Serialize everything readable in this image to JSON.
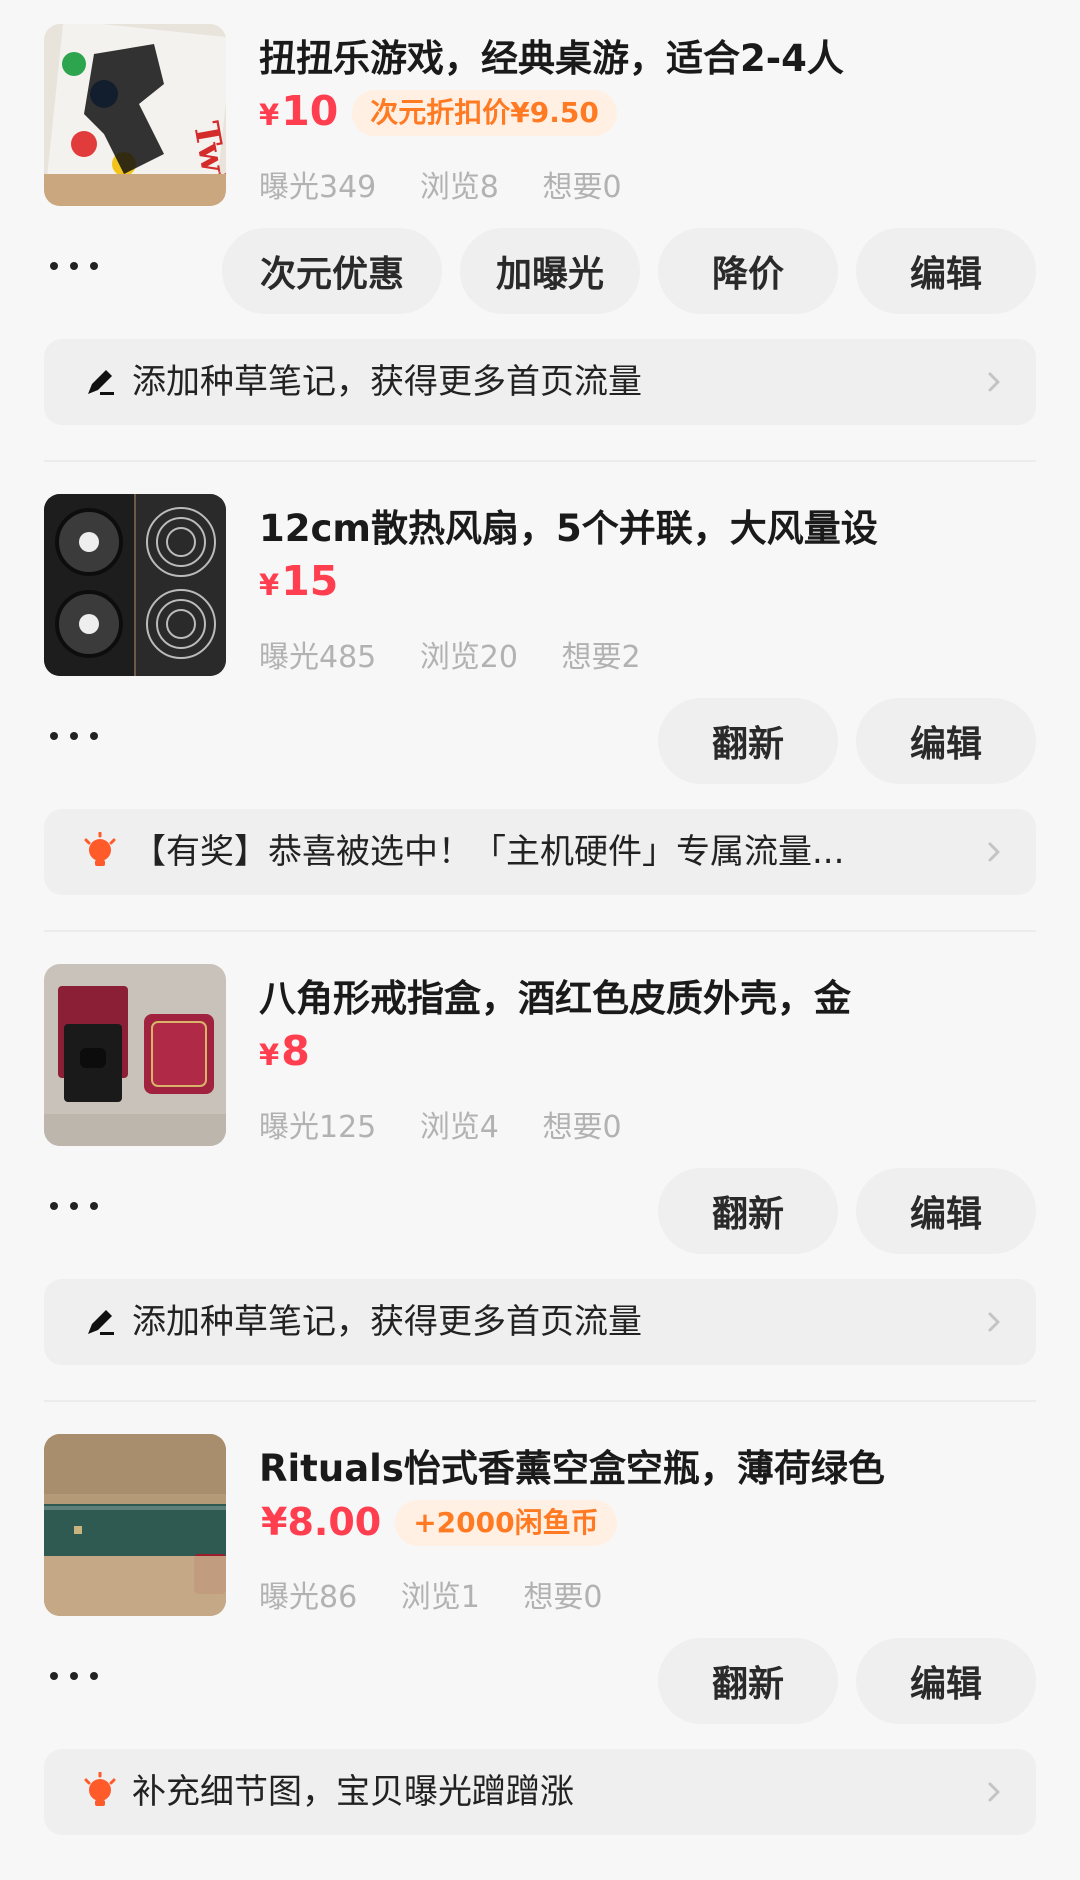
{
  "items": [
    {
      "title": "扭扭乐游戏，经典桌游，适合2-4人",
      "currency": "¥",
      "price": "10",
      "promo": "次元折扣价¥9.50",
      "stats": {
        "exposure": "曝光349",
        "views": "浏览8",
        "wants": "想要0"
      },
      "buttons": [
        "次元优惠",
        "加曝光",
        "降价",
        "编辑"
      ],
      "banner": {
        "icon": "pen-icon",
        "text": "添加种草笔记，获得更多首页流量"
      },
      "thumb_icon": "twister-box-image"
    },
    {
      "title": "12cm散热风扇，5个并联，大风量设",
      "currency": "¥",
      "price": "15",
      "promo": "",
      "stats": {
        "exposure": "曝光485",
        "views": "浏览20",
        "wants": "想要2"
      },
      "buttons": [
        "翻新",
        "编辑"
      ],
      "banner": {
        "icon": "lightbulb-icon",
        "text": "【有奖】恭喜被选中！「主机硬件」专属流量..."
      },
      "thumb_icon": "cooling-fans-image"
    },
    {
      "title": "八角形戒指盒，酒红色皮质外壳，金",
      "currency": "¥",
      "price": "8",
      "promo": "",
      "stats": {
        "exposure": "曝光125",
        "views": "浏览4",
        "wants": "想要0"
      },
      "buttons": [
        "翻新",
        "编辑"
      ],
      "banner": {
        "icon": "pen-icon",
        "text": "添加种草笔记，获得更多首页流量"
      },
      "thumb_icon": "ring-box-image"
    },
    {
      "title": "Rituals怡式香薰空盒空瓶，薄荷绿色",
      "currency": "",
      "price": "¥8.00",
      "promo": "+2000闲鱼币",
      "stats": {
        "exposure": "曝光86",
        "views": "浏览1",
        "wants": "想要0"
      },
      "buttons": [
        "翻新",
        "编辑"
      ],
      "banner": {
        "icon": "lightbulb-icon",
        "text": "补充细节图，宝贝曝光蹭蹭涨"
      },
      "thumb_icon": "rituals-box-image"
    }
  ],
  "colors": {
    "price": "#ff3e4f",
    "promo_text": "#ff7a22",
    "promo_bg": "#fff0e3",
    "button_bg": "#efefef",
    "page_bg": "#f7f7f7"
  }
}
